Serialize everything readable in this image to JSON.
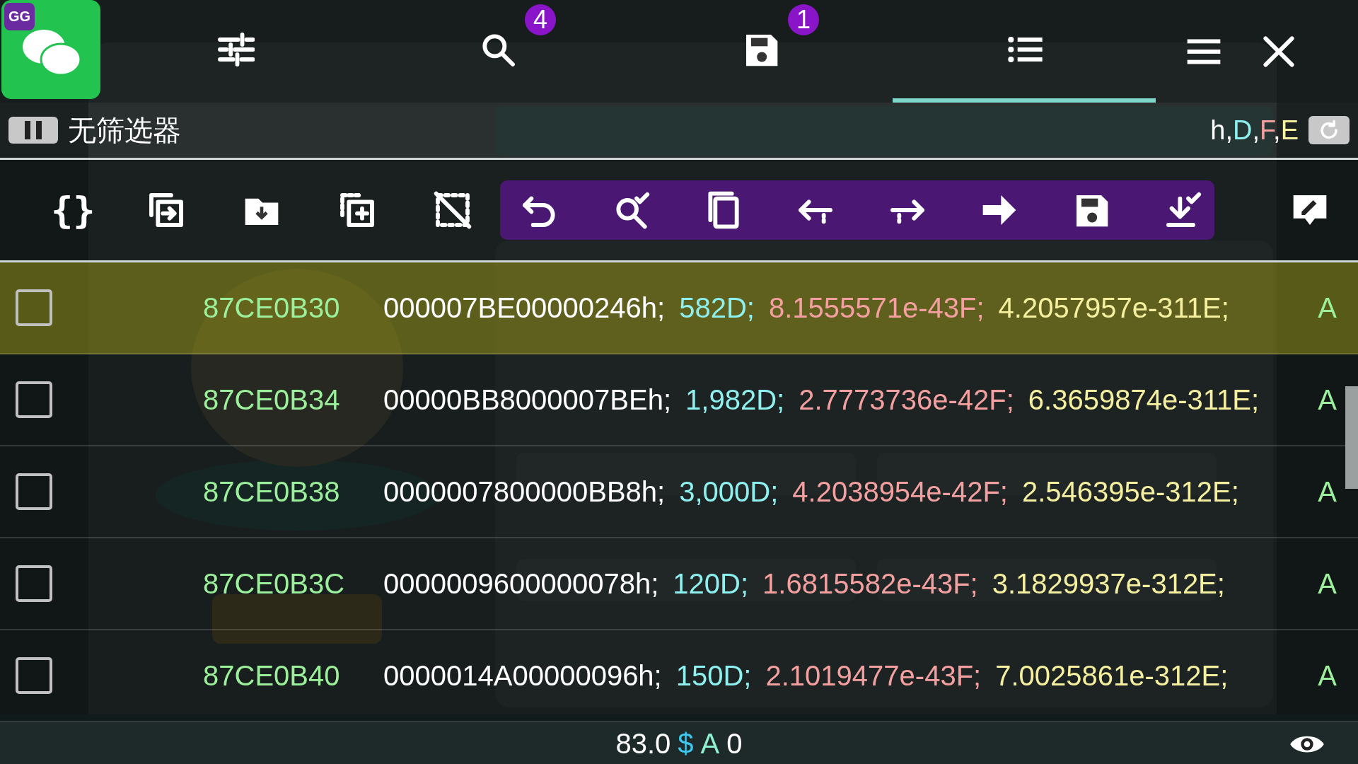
{
  "app_icon": {
    "badge": "GG"
  },
  "tabs": [
    {
      "kind": "sliders",
      "selected": false
    },
    {
      "kind": "search",
      "selected": false,
      "badge": "4"
    },
    {
      "kind": "save",
      "selected": false,
      "badge": "1"
    },
    {
      "kind": "list",
      "selected": true
    }
  ],
  "filter": {
    "label": "无筛选器",
    "types": [
      {
        "text": "h,",
        "color": "#ffffff"
      },
      {
        "text": "D",
        "color": "#8ff0f0"
      },
      {
        "text": ",",
        "color": "#ffffff"
      },
      {
        "text": "F",
        "color": "#f4a0a0"
      },
      {
        "text": ",",
        "color": "#ffffff"
      },
      {
        "text": "E",
        "color": "#f5f0a0"
      }
    ]
  },
  "toolbar": [
    {
      "kind": "braces",
      "text": "{}"
    },
    {
      "kind": "swap"
    },
    {
      "kind": "folder-down"
    },
    {
      "kind": "select-area"
    },
    {
      "kind": "deselect"
    }
  ],
  "toolbar_group": [
    {
      "kind": "undo"
    },
    {
      "kind": "search-check"
    },
    {
      "kind": "copy"
    },
    {
      "kind": "arrow-left"
    },
    {
      "kind": "arrow-right"
    },
    {
      "kind": "arrow-bold"
    },
    {
      "kind": "save"
    },
    {
      "kind": "download-check"
    }
  ],
  "rows": [
    {
      "checked": false,
      "selected": true,
      "address": "87CE0B30",
      "hex": "000007BE00000246h;",
      "dword": "582D;",
      "float": "8.1555571e-43F;",
      "double": "4.2057957e-311E;",
      "type": "A"
    },
    {
      "checked": false,
      "selected": false,
      "address": "87CE0B34",
      "hex": "00000BB8000007BEh;",
      "dword": "1,982D;",
      "float": "2.7773736e-42F;",
      "double": "6.3659874e-311E;",
      "type": "A"
    },
    {
      "checked": false,
      "selected": false,
      "address": "87CE0B38",
      "hex": "0000007800000BB8h;",
      "dword": "3,000D;",
      "float": "4.2038954e-42F;",
      "double": "2.546395e-312E;",
      "type": "A"
    },
    {
      "checked": false,
      "selected": false,
      "address": "87CE0B3C",
      "hex": "0000009600000078h;",
      "dword": "120D;",
      "float": "1.6815582e-43F;",
      "double": "3.1829937e-312E;",
      "type": "A"
    },
    {
      "checked": false,
      "selected": false,
      "address": "87CE0B40",
      "hex": "0000014A00000096h;",
      "dword": "150D;",
      "float": "2.1019477e-43F;",
      "double": "7.0025861e-312E;",
      "type": "A"
    }
  ],
  "status": [
    {
      "text": "83.0",
      "color": "#ffffff"
    },
    {
      "text": "$",
      "color": "#3ec8f0"
    },
    {
      "text": "A",
      "color": "#8ff0d0"
    },
    {
      "text": "0",
      "color": "#ffffff"
    }
  ]
}
